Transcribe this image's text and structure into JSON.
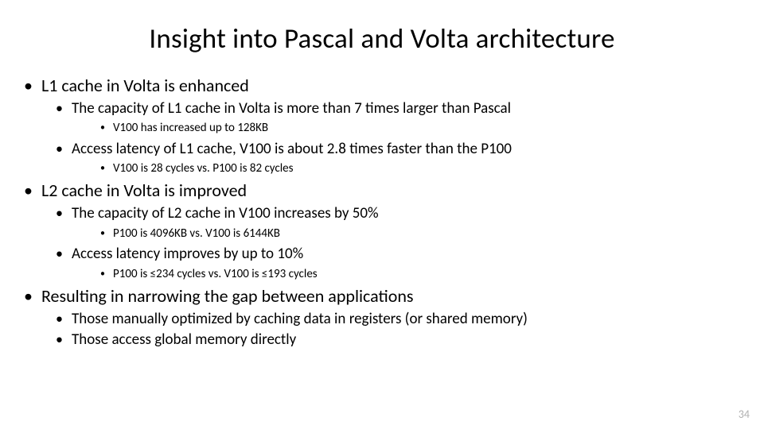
{
  "title": "Insight into Pascal and Volta architecture",
  "page_number": "34",
  "b1": {
    "text": "L1 cache in Volta is enhanced",
    "s1": {
      "text": "The capacity of L1 cache in Volta is more than 7 times larger than Pascal",
      "d1": "V100 has increased up to 128KB"
    },
    "s2": {
      "text": "Access latency of L1 cache, V100 is about 2.8 times faster than the P100",
      "d1": "V100 is 28 cycles vs. P100 is 82 cycles"
    }
  },
  "b2": {
    "text": "L2 cache in Volta is improved",
    "s1": {
      "text": "The capacity of L2 cache in V100 increases by 50%",
      "d1": "P100 is 4096KB vs. V100 is 6144KB"
    },
    "s2": {
      "text": "Access latency improves by up to 10%",
      "d1": "P100 is ≤234 cycles vs. V100 is ≤193 cycles"
    }
  },
  "b3": {
    "text": "Resulting in narrowing the gap between applications",
    "s1": {
      "text": "Those manually optimized by caching data in registers (or shared memory)"
    },
    "s2": {
      "text": "Those access global memory directly"
    }
  }
}
